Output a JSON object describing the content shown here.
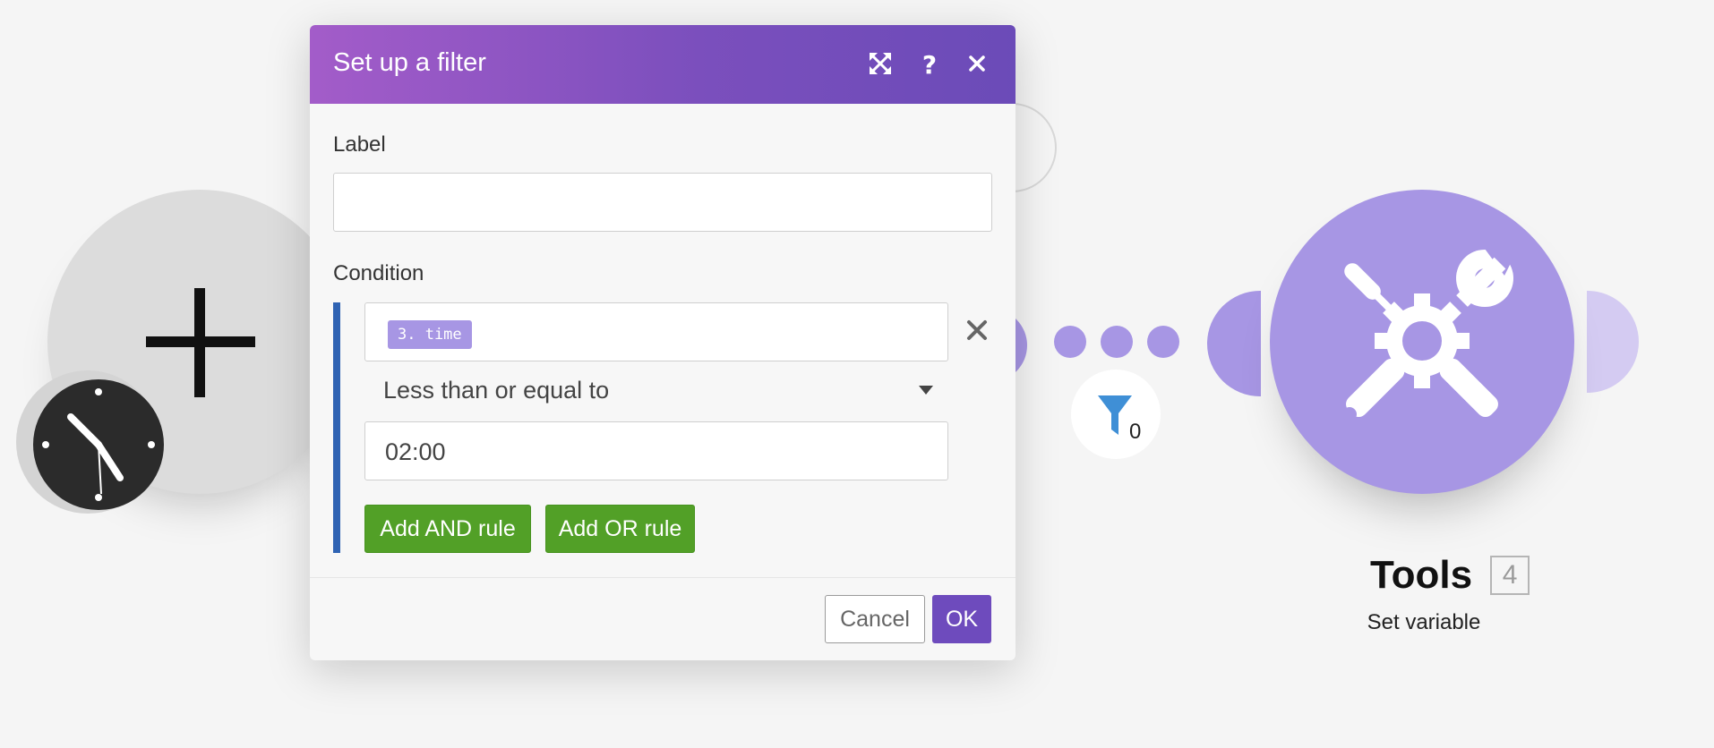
{
  "dialog": {
    "title": "Set up a filter",
    "header_icons": [
      "expand-icon",
      "help-icon",
      "close-icon"
    ],
    "label_caption": "Label",
    "label_value": "",
    "condition_caption": "Condition",
    "condition": {
      "field_token": "3. time",
      "operator": "Less than or equal to",
      "value": "02:00"
    },
    "add_and_label": "Add AND rule",
    "add_or_label": "Add OR rule",
    "cancel_label": "Cancel",
    "ok_label": "OK"
  },
  "route": {
    "filter_count": "0"
  },
  "tools_module": {
    "title": "Tools",
    "id": "4",
    "subtitle": "Set variable"
  },
  "colors": {
    "header_gradient_start": "#a35cc9",
    "header_gradient_end": "#6b4bb8",
    "module_purple": "#a796e4",
    "token_purple": "#a796e4",
    "green_button": "#52a027",
    "ok_button": "#6e4bbd",
    "condition_bar": "#2f63b3",
    "filter_blue": "#3f8fd6"
  }
}
